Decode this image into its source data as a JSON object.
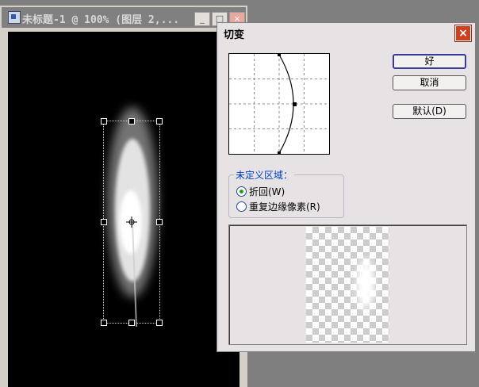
{
  "document_window": {
    "title": "未标题-1 @ 100% (图层 2,...",
    "buttons": {
      "minimize": "_",
      "maximize": "□",
      "close": "×"
    }
  },
  "dialog": {
    "title": "切变",
    "close_label": "×",
    "buttons": {
      "ok": "好",
      "cancel": "取消",
      "default": "默认(D)"
    },
    "undefined_area": {
      "legend": "未定义区域：",
      "options": [
        {
          "label": "折回(W)",
          "selected": true
        },
        {
          "label": "重复边缘像素(R)",
          "selected": false
        }
      ]
    }
  },
  "colors": {
    "selected_radio": "#21a121",
    "group_legend": "#0040c0",
    "dialog_close": "#d0401e"
  },
  "icons": {
    "app": "photoshop-document-icon",
    "close": "close-icon",
    "crosshair": "crosshair-center-icon"
  }
}
